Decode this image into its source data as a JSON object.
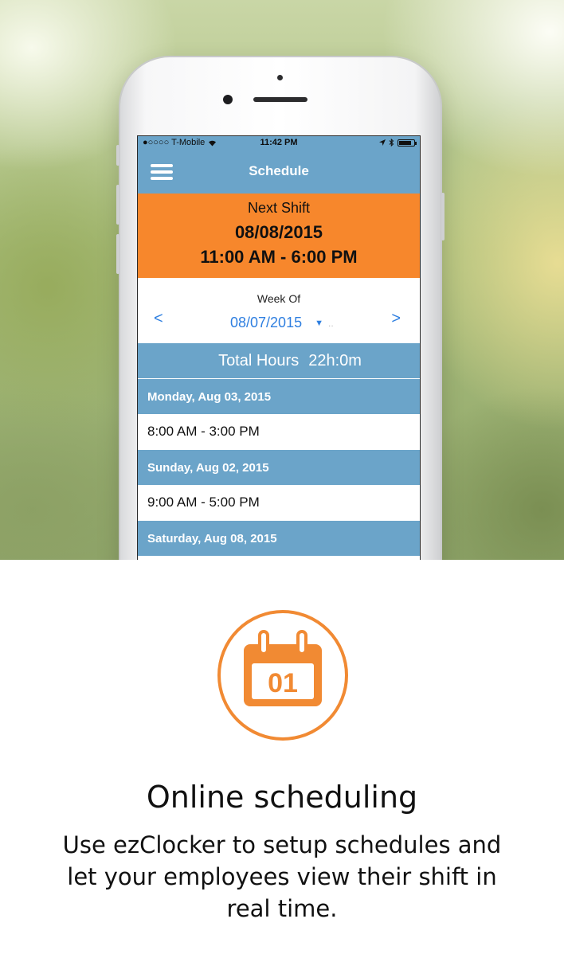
{
  "status_bar": {
    "carrier": "●○○○○ T-Mobile",
    "time": "11:42 PM"
  },
  "navbar": {
    "title": "Schedule",
    "menu_icon": "hamburger-menu-icon"
  },
  "next_shift": {
    "label": "Next Shift",
    "date": "08/08/2015",
    "time_range": "11:00 AM - 6:00 PM"
  },
  "week": {
    "label": "Week Of",
    "prev": "<",
    "next": ">",
    "selected_date": "08/07/2015"
  },
  "total_hours": {
    "label": "Total Hours",
    "value": "22h:0m"
  },
  "days": [
    {
      "header": "Monday, Aug 03, 2015",
      "shift": "8:00 AM - 3:00 PM"
    },
    {
      "header": "Sunday, Aug 02, 2015",
      "shift": "9:00 AM - 5:00 PM"
    },
    {
      "header": "Saturday, Aug 08, 2015"
    }
  ],
  "feature": {
    "icon": "calendar-icon",
    "icon_text": "01",
    "title": "Online scheduling",
    "description": "Use ezClocker to setup schedules and let your employees view their shift in real time."
  },
  "colors": {
    "accent_blue": "#6ba4c9",
    "orange": "#f7872c",
    "link_blue": "#2f7fe0"
  }
}
